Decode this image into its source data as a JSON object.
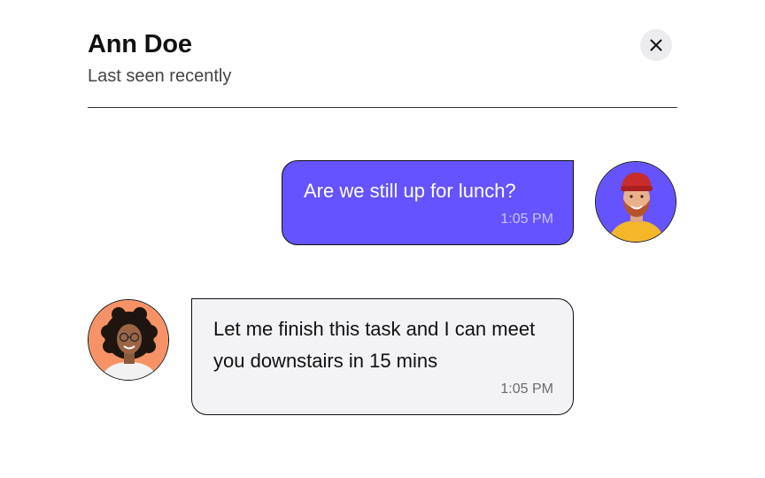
{
  "header": {
    "title": "Ann Doe",
    "status": "Last seen recently",
    "close_icon": "close-icon"
  },
  "messages": [
    {
      "direction": "outgoing",
      "text": "Are we still up for lunch?",
      "time": "1:05 PM",
      "avatar": "avatar-man-red-beanie",
      "bubble_color": "#6553ff"
    },
    {
      "direction": "incoming",
      "text": "Let me finish this task and I can meet you downstairs in 15 mins",
      "time": "1:05 PM",
      "avatar": "avatar-woman-curly-hair",
      "bubble_color": "#f3f3f6"
    }
  ],
  "colors": {
    "accent": "#6553ff",
    "outgoing_avatar_bg": "#6553ff",
    "incoming_avatar_bg": "#f79266"
  }
}
